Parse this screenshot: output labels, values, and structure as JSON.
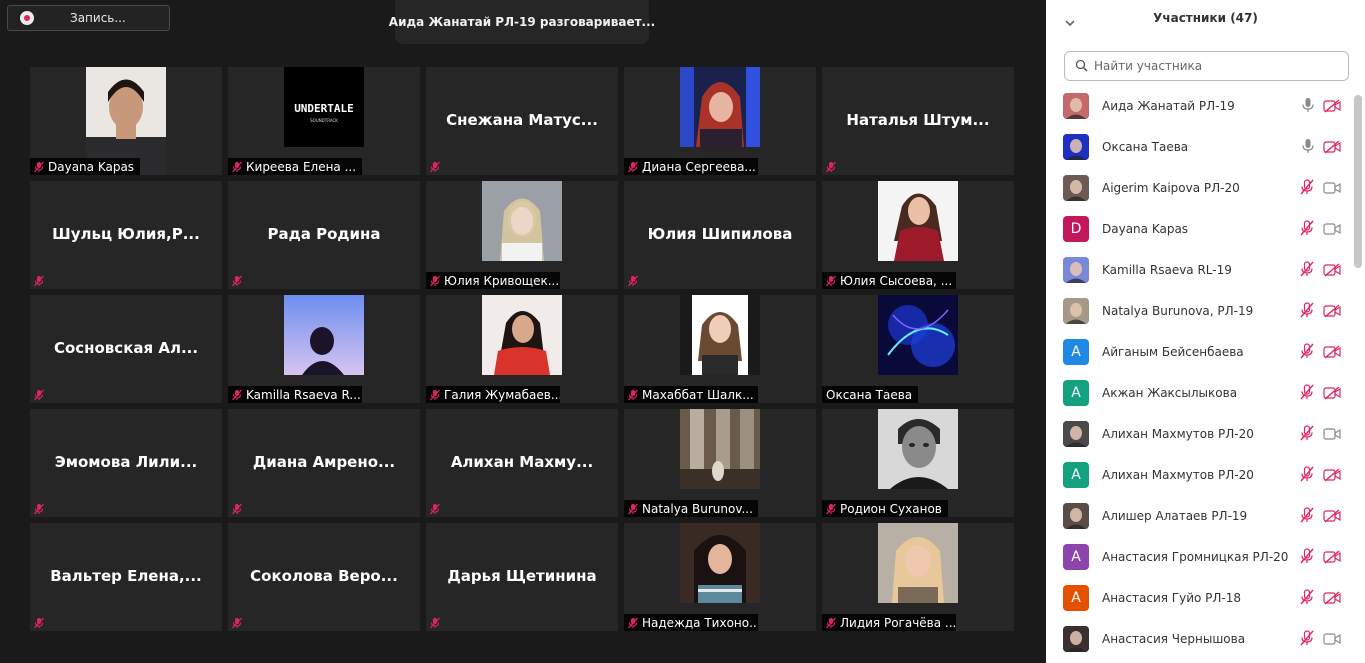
{
  "recording": {
    "label": "Запись..."
  },
  "speaker_banner": "Аида Жанатай РЛ-19 разговаривает...",
  "tiles": [
    {
      "name": "Dayana Kapas",
      "big": "",
      "photo": "dayana"
    },
    {
      "name": "Киреева Елена ...",
      "big": "",
      "photo": "undertale"
    },
    {
      "name": "",
      "big": "Снежана  Матус...",
      "photo": ""
    },
    {
      "name": "Диана Сергеева...",
      "big": "",
      "photo": "diana"
    },
    {
      "name": "",
      "big": "Наталья  Штум...",
      "photo": ""
    },
    {
      "name": "",
      "big": "Шульц  Юлия,Р...",
      "photo": ""
    },
    {
      "name": "",
      "big": "Рада Родина",
      "photo": ""
    },
    {
      "name": "Юлия Кривощек...",
      "big": "",
      "photo": "yulia_k"
    },
    {
      "name": "",
      "big": "Юлия Шипилова",
      "photo": ""
    },
    {
      "name": "Юлия Сысоева, ...",
      "big": "",
      "photo": "yulia_s"
    },
    {
      "name": "",
      "big": "Сосновская  Ал...",
      "photo": ""
    },
    {
      "name": "Kamilla Rsaeva R...",
      "big": "",
      "photo": "kamilla"
    },
    {
      "name": "Галия Жумабаев...",
      "big": "",
      "photo": "galia"
    },
    {
      "name": "Махаббат Шалк...",
      "big": "",
      "photo": "mahabbat"
    },
    {
      "name": "Оксана Таева",
      "big": "",
      "photo": "oksana",
      "unmuted": true
    },
    {
      "name": "",
      "big": "Эмомова  Лили...",
      "photo": ""
    },
    {
      "name": "",
      "big": "Диана  Амрено...",
      "photo": ""
    },
    {
      "name": "",
      "big": "Алихан  Махму...",
      "photo": ""
    },
    {
      "name": "Natalya Burunov...",
      "big": "",
      "photo": "natalya"
    },
    {
      "name": "Родион Суханов",
      "big": "",
      "photo": "rodion"
    },
    {
      "name": "",
      "big": "Вальтер  Елена,...",
      "photo": ""
    },
    {
      "name": "",
      "big": "Соколова  Веро...",
      "photo": ""
    },
    {
      "name": "",
      "big": "Дарья Щетинина",
      "photo": ""
    },
    {
      "name": "Надежда Тихоно...",
      "big": "",
      "photo": "nadezhda"
    },
    {
      "name": "Лидия Рогачёва ...",
      "big": "",
      "photo": "lidia"
    }
  ],
  "panel": {
    "title": "Участники (47)",
    "search_placeholder": "Найти участника",
    "participants": [
      {
        "name": "Аида Жанатай РЛ-19",
        "avatar": "photo",
        "color": "#c46a6a",
        "mic": "on",
        "cam": "off"
      },
      {
        "name": "Оксана Таева",
        "avatar": "photo",
        "color": "#1f2fbf",
        "mic": "on",
        "cam": "off"
      },
      {
        "name": "Aigerim Kaipova РЛ-20",
        "avatar": "photo",
        "color": "#6b5a55",
        "mic": "off",
        "cam": "on"
      },
      {
        "name": "Dayana Kapas",
        "avatar": "D",
        "color": "#c2185b",
        "mic": "off",
        "cam": "on"
      },
      {
        "name": "Kamilla Rsaeva RL-19",
        "avatar": "photo",
        "color": "#7a88d8",
        "mic": "off",
        "cam": "off"
      },
      {
        "name": "Natalya Burunova, РЛ-19",
        "avatar": "photo",
        "color": "#a59a88",
        "mic": "off",
        "cam": "off"
      },
      {
        "name": "Айганым Бейсенбаева",
        "avatar": "А",
        "color": "#1e88e5",
        "mic": "off",
        "cam": "off"
      },
      {
        "name": "Акжан Жаксылыкова",
        "avatar": "А",
        "color": "#13a17e",
        "mic": "off",
        "cam": "off"
      },
      {
        "name": "Алихан Махмутов РЛ-20",
        "avatar": "photo",
        "color": "#4a4a4a",
        "mic": "off",
        "cam": "on"
      },
      {
        "name": "Алихан Махмутов РЛ-20",
        "avatar": "А",
        "color": "#13a17e",
        "mic": "off",
        "cam": "off"
      },
      {
        "name": "Алишер Алатаев РЛ-19",
        "avatar": "photo",
        "color": "#5a4d48",
        "mic": "off",
        "cam": "off"
      },
      {
        "name": "Анастасия Громницкая РЛ-20",
        "avatar": "А",
        "color": "#8e44ad",
        "mic": "off",
        "cam": "off"
      },
      {
        "name": "Анастасия Гуйо РЛ-18",
        "avatar": "А",
        "color": "#e65100",
        "mic": "off",
        "cam": "off"
      },
      {
        "name": "Анастасия Чернышова",
        "avatar": "photo",
        "color": "#3a3030",
        "mic": "off",
        "cam": "on"
      }
    ]
  },
  "colors": {
    "muted_red": "#e0245e",
    "panel_bg": "#ffffff",
    "tile_bg": "#262626"
  }
}
